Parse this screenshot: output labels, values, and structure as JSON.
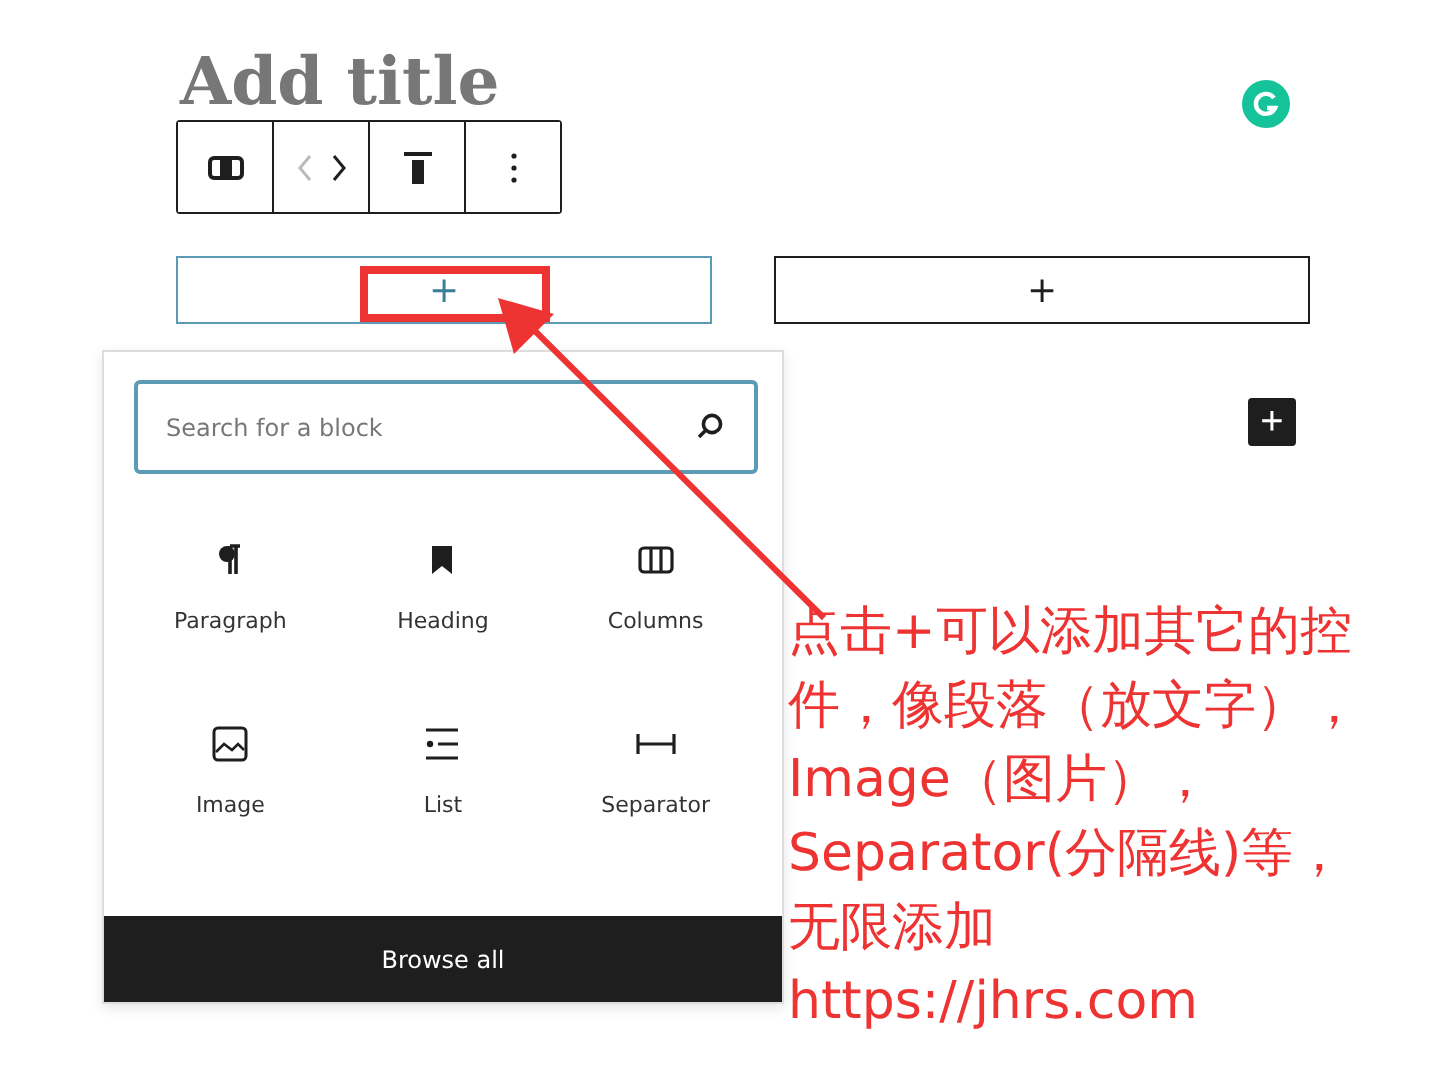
{
  "editor": {
    "title_placeholder": "Add title"
  },
  "columns": [
    {
      "appender": "+",
      "focused": true
    },
    {
      "appender": "+",
      "focused": false
    }
  ],
  "inserter": {
    "search": {
      "placeholder": "Search for a block"
    },
    "blocks": [
      {
        "label": "Paragraph"
      },
      {
        "label": "Heading"
      },
      {
        "label": "Columns"
      },
      {
        "label": "Image"
      },
      {
        "label": "List"
      },
      {
        "label": "Separator"
      }
    ],
    "browse_all": "Browse all"
  },
  "add_block_button": "+",
  "annotation": {
    "lines": [
      "点击+可以添加其它的控",
      "件，像段落（放文字），",
      "Image（图片），",
      "Separator(分隔线)等，",
      "无限添加",
      "https://jhrs.com"
    ]
  }
}
